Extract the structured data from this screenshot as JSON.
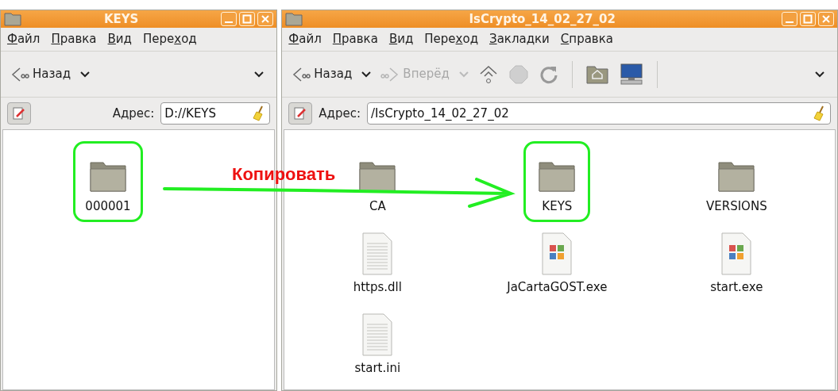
{
  "windows": [
    {
      "title": "KEYS",
      "menu": [
        {
          "key": "Ф",
          "after": "айл"
        },
        {
          "key": "П",
          "after": "равка"
        },
        {
          "key": "В",
          "after": "ид"
        },
        {
          "before": "Пере",
          "key": "х",
          "after": "од"
        }
      ],
      "toolbar": [
        {
          "kind": "back",
          "label": "Назад",
          "disabled": false
        },
        {
          "kind": "overflow",
          "disabled": false
        }
      ],
      "address": {
        "label": "Адрес:",
        "value": "D://KEYS"
      },
      "items": [
        {
          "kind": "folder",
          "name": "000001",
          "circled": true
        }
      ]
    },
    {
      "title": "IsCrypto_14_02_27_02",
      "menu": [
        {
          "key": "Ф",
          "after": "айл"
        },
        {
          "key": "П",
          "after": "равка"
        },
        {
          "key": "В",
          "after": "ид"
        },
        {
          "before": "Пере",
          "key": "х",
          "after": "од"
        },
        {
          "key": "З",
          "after": "акладки"
        },
        {
          "key": "С",
          "after": "правка"
        }
      ],
      "toolbar": [
        {
          "kind": "back",
          "label": "Назад",
          "disabled": false
        },
        {
          "kind": "forward",
          "label": "Вперёд",
          "disabled": true
        },
        {
          "kind": "up",
          "disabled": false
        },
        {
          "kind": "stop",
          "disabled": true
        },
        {
          "kind": "reload",
          "disabled": false
        },
        {
          "kind": "separator"
        },
        {
          "kind": "home"
        },
        {
          "kind": "computer"
        },
        {
          "kind": "separator"
        },
        {
          "kind": "overflow",
          "disabled": false
        }
      ],
      "address": {
        "label": "Адрес:",
        "value": "/IsCrypto_14_02_27_02"
      },
      "items": [
        {
          "kind": "folder",
          "name": "CA",
          "circled": false
        },
        {
          "kind": "folder",
          "name": "KEYS",
          "circled": true
        },
        {
          "kind": "folder",
          "name": "VERSIONS",
          "circled": false
        },
        {
          "kind": "text",
          "name": "https.dll",
          "circled": false
        },
        {
          "kind": "exe",
          "name": "JaCartaGOST.exe",
          "circled": false
        },
        {
          "kind": "exe",
          "name": "start.exe",
          "circled": false
        },
        {
          "kind": "text",
          "name": "start.ini",
          "circled": false
        }
      ]
    }
  ],
  "annotation": {
    "label": "Копировать"
  }
}
